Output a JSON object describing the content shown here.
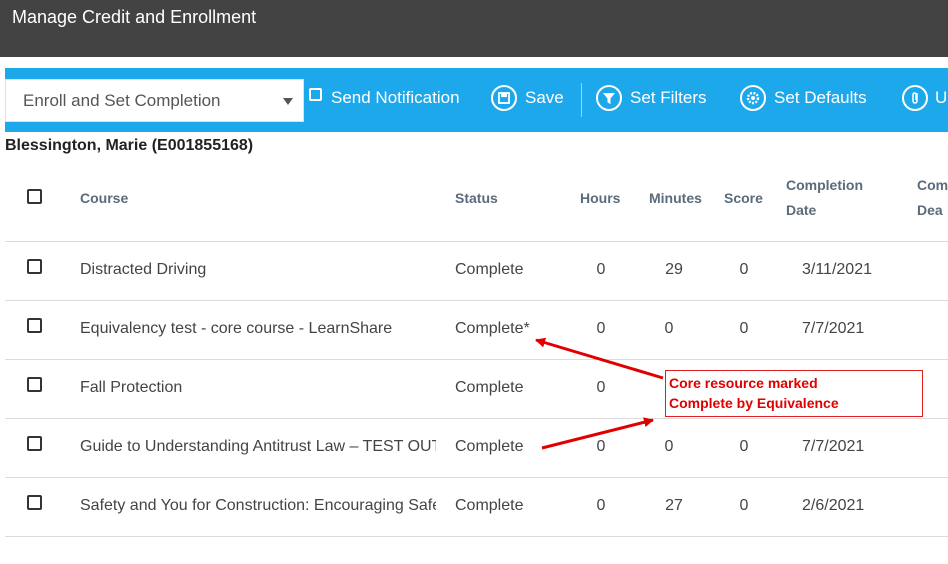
{
  "window": {
    "title": "Manage Credit and Enrollment"
  },
  "toolbar": {
    "mode_select": "Enroll and Set Completion",
    "send_notification": "Send Notification",
    "save": "Save",
    "set_filters": "Set Filters",
    "set_defaults": "Set Defaults",
    "upload_partial": "U"
  },
  "employee": "Blessington, Marie (E001855168)",
  "table": {
    "headers": {
      "course": "Course",
      "status": "Status",
      "hours": "Hours",
      "minutes": "Minutes",
      "score": "Score",
      "completion_date_line1": "Completion",
      "completion_date_line2": "Date",
      "deadline_line1": "Com",
      "deadline_line2": "Dea"
    },
    "rows": [
      {
        "course": "Distracted Driving",
        "status": "Complete",
        "hours": "0",
        "minutes": "29",
        "score": "0",
        "date": "3/11/2021"
      },
      {
        "course": "Equivalency test - core course - LearnShare",
        "status": "Complete*",
        "hours": "0",
        "minutes": "0",
        "score": "0",
        "date": "7/7/2021"
      },
      {
        "course": "Fall Protection",
        "status": "Complete",
        "hours": "0",
        "minutes": "",
        "score": "",
        "date": ""
      },
      {
        "course": "Guide to Understanding Antitrust Law – TEST OUT",
        "status": "Complete",
        "hours": "0",
        "minutes": "0",
        "score": "0",
        "date": "7/7/2021"
      },
      {
        "course": "Safety and You for Construction: Encouraging Safe",
        "status": "Complete",
        "hours": "0",
        "minutes": "27",
        "score": "0",
        "date": "2/6/2021"
      }
    ]
  },
  "annotation": {
    "line1": "Core resource marked",
    "line2": "Complete by Equivalence",
    "color": "#e00000"
  },
  "colors": {
    "toolbar": "#1ea8ec",
    "titlebar": "#434343"
  },
  "icons": [
    "chevron-down-icon",
    "save-icon",
    "filter-icon",
    "gear-icon",
    "paperclip-icon"
  ]
}
